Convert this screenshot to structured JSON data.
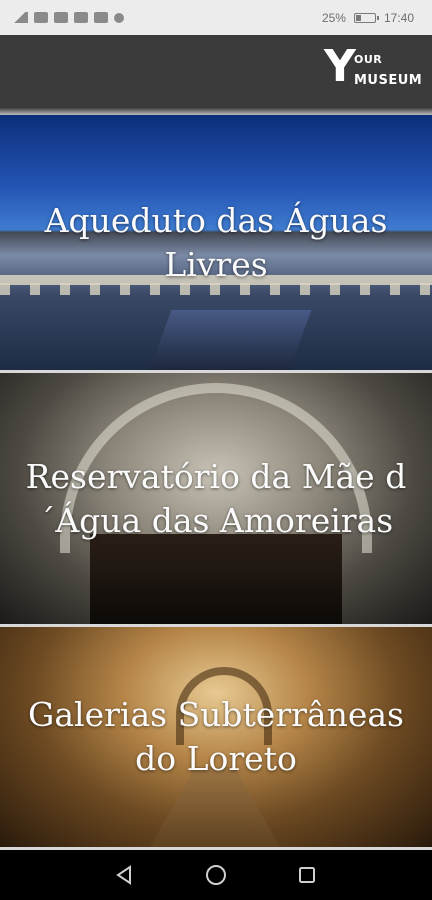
{
  "status_bar": {
    "battery": "25%",
    "time": "17:40",
    "left_icons": [
      "signal-icon",
      "wifi-icon",
      "notification-icon",
      "notification-icon",
      "notification-icon",
      "notification-icon"
    ]
  },
  "app": {
    "logo_letter": "Y",
    "logo_our": "OUR",
    "logo_museum": "MUSEUM"
  },
  "museums": [
    {
      "title": "Aqueduto das Águas Livres"
    },
    {
      "title": "Reservatório da Mãe d´Água das Amoreiras"
    },
    {
      "title": "Galerias Subterrâneas do Loreto"
    }
  ],
  "nav": {
    "back": "back-icon",
    "home": "home-icon",
    "recents": "recents-icon"
  },
  "colors": {
    "appbar": "#3b3b3b",
    "statusbar": "#ececec",
    "navbar": "#000000",
    "title_text": "#fbfbfb"
  }
}
